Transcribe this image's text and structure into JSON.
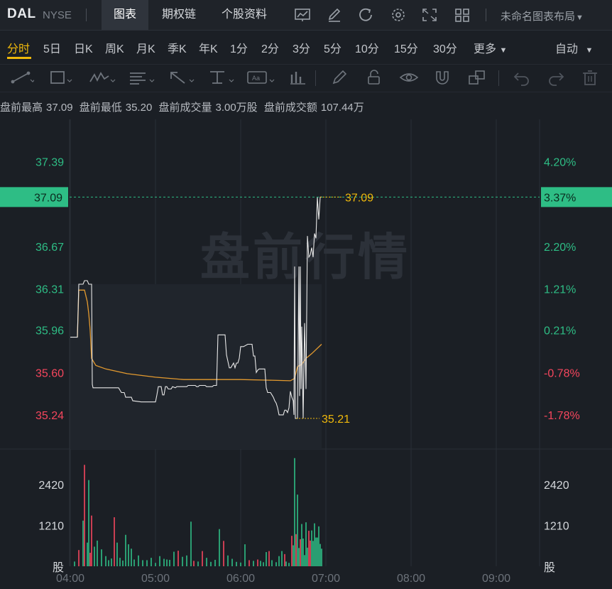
{
  "header": {
    "ticker": "DAL",
    "exchange": "NYSE",
    "tabs": [
      "图表",
      "期权链",
      "个股资料"
    ],
    "active_tab": "图表",
    "layout_label": "未命名图表布局"
  },
  "periods": {
    "items": [
      "分时",
      "5日",
      "日K",
      "周K",
      "月K",
      "季K",
      "年K",
      "1分",
      "2分",
      "3分",
      "5分",
      "10分",
      "15分",
      "30分",
      "更多"
    ],
    "active": "分时",
    "auto_label": "自动"
  },
  "toolbar_icons": [
    "trendline-icon",
    "rectangle-icon",
    "pattern-icon",
    "text-tool-icon",
    "arrow-icon",
    "measure-icon",
    "annotation-icon",
    "indicator-icon",
    "pen-icon",
    "lock-icon",
    "eye-icon",
    "magnet-icon",
    "layers-icon",
    "undo-icon",
    "redo-icon",
    "trash-icon"
  ],
  "info_bar": {
    "high_label": "盘前最高",
    "high_value": "37.09",
    "low_label": "盘前最低",
    "low_value": "35.20",
    "vol_label": "盘前成交量",
    "vol_value": "3.00万股",
    "amt_label": "盘前成交额",
    "amt_value": "107.44万"
  },
  "watermark": "盘前行情",
  "colors": {
    "up": "#2ebd85",
    "down": "#f6465d",
    "accent": "#f0b90b",
    "price_line": "#e8e8e8",
    "avg_line": "#e39a2f"
  },
  "chart_data": {
    "type": "line",
    "x_ticks": [
      "04:00",
      "05:00",
      "06:00",
      "07:00",
      "08:00",
      "09:00"
    ],
    "price_ticks": [
      "37.39",
      "36.67",
      "36.31",
      "35.96",
      "35.60",
      "35.24"
    ],
    "pct_ticks": [
      "4.20%",
      "2.20%",
      "1.21%",
      "0.21%",
      "-0.78%",
      "-1.78%"
    ],
    "ylim": [
      34.95,
      37.75
    ],
    "prev_close": 35.88,
    "current": {
      "price": "37.09",
      "pct": "3.37%"
    },
    "high_label": "37.09",
    "low_label": "35.21",
    "volume_ticks": [
      "2420",
      "1210"
    ],
    "volume_unit": "股",
    "volume_ylim": [
      0,
      3300
    ],
    "price_series": [
      [
        0,
        35.9
      ],
      [
        5,
        35.9
      ],
      [
        6,
        36.35
      ],
      [
        9,
        36.35
      ],
      [
        10,
        36.38
      ],
      [
        12,
        36.38
      ],
      [
        13,
        36.35
      ],
      [
        15,
        36.35
      ],
      [
        15.5,
        35.5
      ],
      [
        16,
        35.47
      ],
      [
        30,
        35.47
      ],
      [
        34,
        35.47
      ],
      [
        35,
        35.45
      ],
      [
        36,
        35.43
      ],
      [
        37,
        35.43
      ],
      [
        38,
        35.43
      ],
      [
        39,
        35.39
      ],
      [
        43,
        35.39
      ],
      [
        44,
        35.36
      ],
      [
        50,
        35.35
      ],
      [
        58,
        35.35
      ],
      [
        59,
        35.35
      ],
      [
        60,
        35.35
      ],
      [
        61,
        35.41
      ],
      [
        62,
        35.48
      ],
      [
        64,
        35.48
      ],
      [
        65,
        35.41
      ],
      [
        66,
        35.41
      ],
      [
        67,
        35.48
      ],
      [
        68,
        35.48
      ],
      [
        69,
        35.46
      ],
      [
        71,
        35.46
      ],
      [
        72,
        35.48
      ],
      [
        74,
        35.47
      ],
      [
        75,
        35.48
      ],
      [
        82,
        35.48
      ],
      [
        83,
        35.49
      ],
      [
        88,
        35.49
      ],
      [
        89,
        35.48
      ],
      [
        90,
        35.48
      ],
      [
        91,
        35.49
      ],
      [
        95,
        35.49
      ],
      [
        96,
        35.48
      ],
      [
        100,
        35.48
      ],
      [
        101,
        35.49
      ],
      [
        103,
        35.49
      ],
      [
        104,
        35.92
      ],
      [
        109,
        35.92
      ],
      [
        110,
        35.75
      ],
      [
        112,
        35.64
      ],
      [
        113,
        35.64
      ],
      [
        114,
        35.66
      ],
      [
        115,
        35.68
      ],
      [
        116,
        35.64
      ],
      [
        117,
        35.68
      ],
      [
        118,
        35.68
      ],
      [
        119,
        35.72
      ],
      [
        120,
        35.82
      ],
      [
        121,
        35.82
      ],
      [
        122,
        35.82
      ],
      [
        125,
        35.84
      ],
      [
        126,
        35.84
      ],
      [
        127,
        35.84
      ],
      [
        128,
        35.84
      ],
      [
        129,
        35.74
      ],
      [
        130,
        35.74
      ],
      [
        131,
        35.6
      ],
      [
        132,
        35.62
      ],
      [
        133,
        35.63
      ],
      [
        137,
        35.63
      ],
      [
        138,
        35.47
      ],
      [
        139,
        35.43
      ],
      [
        140,
        35.43
      ],
      [
        141,
        35.43
      ],
      [
        142,
        35.41
      ],
      [
        143,
        35.39
      ],
      [
        144,
        35.36
      ],
      [
        145,
        35.34
      ],
      [
        146,
        35.3
      ],
      [
        147,
        35.24
      ],
      [
        148,
        35.24
      ],
      [
        150,
        35.24
      ],
      [
        151,
        35.28
      ],
      [
        152,
        35.28
      ],
      [
        153,
        35.26
      ],
      [
        154,
        35.3
      ],
      [
        155,
        35.44
      ],
      [
        156,
        35.39
      ],
      [
        157,
        35.36
      ],
      [
        157.5,
        35.24
      ],
      [
        158,
        36.5
      ],
      [
        158.5,
        35.21
      ],
      [
        159,
        35.21
      ],
      [
        160,
        35.21
      ],
      [
        161,
        36.5
      ],
      [
        161.5,
        35.4
      ],
      [
        162,
        36.5
      ],
      [
        162.5,
        35.46
      ],
      [
        163,
        35.99
      ],
      [
        164,
        35.21
      ],
      [
        165,
        36.02
      ],
      [
        166,
        35.46
      ],
      [
        167,
        36.76
      ],
      [
        168,
        36.58
      ],
      [
        169,
        36.6
      ],
      [
        170,
        36.66
      ],
      [
        171,
        36.58
      ],
      [
        172,
        36.78
      ],
      [
        173,
        36.74
      ],
      [
        174,
        37.09
      ],
      [
        175,
        36.9
      ],
      [
        176,
        37.09
      ],
      [
        177,
        37.09
      ]
    ],
    "avg_series": [
      [
        5,
        35.9
      ],
      [
        6,
        36.3
      ],
      [
        9,
        36.3
      ],
      [
        10,
        36.3
      ],
      [
        12,
        36.2
      ],
      [
        13,
        36.1
      ],
      [
        14,
        35.96
      ],
      [
        15,
        35.72
      ],
      [
        18,
        35.66
      ],
      [
        25,
        35.63
      ],
      [
        40,
        35.59
      ],
      [
        60,
        35.56
      ],
      [
        80,
        35.54
      ],
      [
        100,
        35.54
      ],
      [
        120,
        35.54
      ],
      [
        140,
        35.535
      ],
      [
        155,
        35.53
      ],
      [
        158,
        35.55
      ],
      [
        160,
        35.65
      ],
      [
        163,
        35.67
      ],
      [
        166,
        35.72
      ],
      [
        170,
        35.76
      ],
      [
        177,
        35.84
      ]
    ],
    "volume_series": [
      [
        3,
        140,
        1
      ],
      [
        6,
        480,
        0
      ],
      [
        9,
        1350,
        1
      ],
      [
        10,
        3000,
        0
      ],
      [
        12,
        700,
        1
      ],
      [
        13,
        2550,
        1
      ],
      [
        14,
        400,
        0
      ],
      [
        15,
        1500,
        0
      ],
      [
        17,
        580,
        1
      ],
      [
        19,
        760,
        1
      ],
      [
        22,
        500,
        1
      ],
      [
        25,
        300,
        1
      ],
      [
        27,
        180,
        1
      ],
      [
        29,
        230,
        1
      ],
      [
        31,
        1450,
        0
      ],
      [
        33,
        700,
        1
      ],
      [
        35,
        250,
        1
      ],
      [
        37,
        170,
        1
      ],
      [
        39,
        930,
        1
      ],
      [
        41,
        650,
        1
      ],
      [
        43,
        520,
        1
      ],
      [
        45,
        200,
        1
      ],
      [
        48,
        320,
        1
      ],
      [
        51,
        180,
        1
      ],
      [
        54,
        180,
        1
      ],
      [
        57,
        250,
        1
      ],
      [
        60,
        100,
        1
      ],
      [
        63,
        300,
        1
      ],
      [
        66,
        220,
        1
      ],
      [
        68,
        200,
        1
      ],
      [
        70,
        190,
        1
      ],
      [
        73,
        430,
        1
      ],
      [
        76,
        460,
        0
      ],
      [
        79,
        280,
        1
      ],
      [
        82,
        320,
        1
      ],
      [
        85,
        1320,
        1
      ],
      [
        87,
        160,
        0
      ],
      [
        90,
        140,
        1
      ],
      [
        93,
        450,
        0
      ],
      [
        96,
        250,
        1
      ],
      [
        99,
        130,
        1
      ],
      [
        102,
        190,
        1
      ],
      [
        105,
        1100,
        1
      ],
      [
        108,
        750,
        0
      ],
      [
        111,
        320,
        1
      ],
      [
        114,
        220,
        1
      ],
      [
        117,
        130,
        1
      ],
      [
        120,
        110,
        1
      ],
      [
        123,
        650,
        1
      ],
      [
        126,
        180,
        0
      ],
      [
        129,
        160,
        1
      ],
      [
        132,
        200,
        0
      ],
      [
        134,
        160,
        1
      ],
      [
        136,
        120,
        1
      ],
      [
        138,
        420,
        1
      ],
      [
        140,
        450,
        0
      ],
      [
        142,
        180,
        1
      ],
      [
        145,
        120,
        1
      ],
      [
        147,
        300,
        1
      ],
      [
        149,
        450,
        1
      ],
      [
        151,
        360,
        0
      ],
      [
        152,
        140,
        1
      ],
      [
        154,
        100,
        1
      ],
      [
        156,
        900,
        0
      ],
      [
        157,
        620,
        1
      ],
      [
        158,
        3200,
        1
      ],
      [
        159,
        950,
        0
      ],
      [
        160,
        2120,
        1
      ],
      [
        161,
        540,
        1
      ],
      [
        162,
        800,
        0
      ],
      [
        163,
        1250,
        1
      ],
      [
        164,
        820,
        1
      ],
      [
        165,
        330,
        1
      ],
      [
        166,
        1300,
        1
      ],
      [
        167,
        550,
        1
      ],
      [
        168,
        1050,
        0
      ],
      [
        169,
        760,
        0
      ],
      [
        170,
        1060,
        1
      ],
      [
        171,
        750,
        1
      ],
      [
        172,
        1270,
        1
      ],
      [
        173,
        850,
        1
      ],
      [
        174,
        850,
        1
      ],
      [
        175,
        1180,
        1
      ],
      [
        176,
        660,
        1
      ],
      [
        177,
        520,
        1
      ]
    ]
  }
}
